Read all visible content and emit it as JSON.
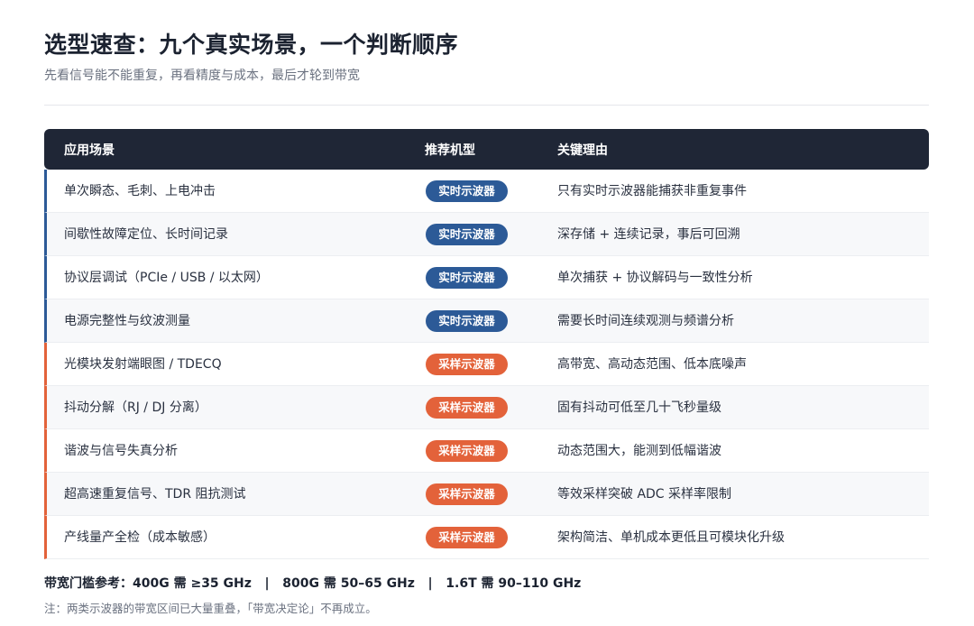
{
  "header": {
    "title": "选型速查：九个真实场景，一个判断顺序",
    "subtitle": "先看信号能不能重复，再看精度与成本，最后才轮到带宽"
  },
  "table": {
    "columns": [
      "应用场景",
      "推荐机型",
      "关键理由"
    ],
    "rows": [
      {
        "scene": "单次瞬态、毛刺、上电冲击",
        "type": "实时示波器",
        "reason": "只有实时示波器能捕获非重复事件"
      },
      {
        "scene": "间歇性故障定位、长时间记录",
        "type": "实时示波器",
        "reason": "深存储 + 连续记录，事后可回溯"
      },
      {
        "scene": "协议层调试（PCIe / USB / 以太网）",
        "type": "实时示波器",
        "reason": "单次捕获 + 协议解码与一致性分析"
      },
      {
        "scene": "电源完整性与纹波测量",
        "type": "实时示波器",
        "reason": "需要长时间连续观测与频谱分析"
      },
      {
        "scene": "光模块发射端眼图 / TDECQ",
        "type": "采样示波器",
        "reason": "高带宽、高动态范围、低本底噪声"
      },
      {
        "scene": "抖动分解（RJ / DJ 分离）",
        "type": "采样示波器",
        "reason": "固有抖动可低至几十飞秒量级"
      },
      {
        "scene": "谐波与信号失真分析",
        "type": "采样示波器",
        "reason": "动态范围大，能测到低幅谐波"
      },
      {
        "scene": "超高速重复信号、TDR 阻抗测试",
        "type": "采样示波器",
        "reason": "等效采样突破 ADC 采样率限制"
      },
      {
        "scene": "产线量产全检（成本敏感）",
        "type": "采样示波器",
        "reason": "架构简洁、单机成本更低且可模块化升级"
      }
    ]
  },
  "footer": {
    "bandwidth": "带宽门槛参考：400G 需 ≥35 GHz   |   800G 需 50–65 GHz   |   1.6T 需 90–110 GHz",
    "note": "注：两类示波器的带宽区间已大量重叠，「带宽决定论」不再成立。"
  },
  "colors": {
    "realtime": "#2c5a97",
    "sampling": "#e3623a",
    "header_bg": "#1f2636"
  }
}
